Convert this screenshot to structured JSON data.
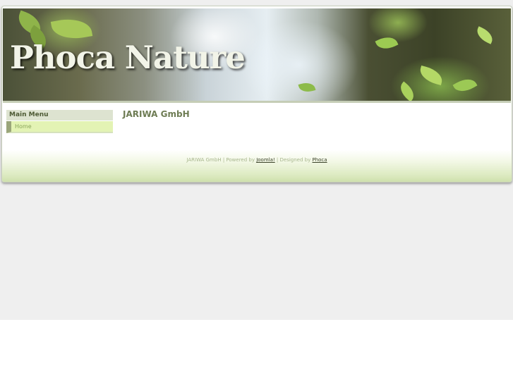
{
  "header": {
    "site_title": "Phoca Nature"
  },
  "sidebar": {
    "title": "Main Menu",
    "items": [
      {
        "label": "Home"
      }
    ]
  },
  "main": {
    "title": "JARIWA GmbH"
  },
  "footer": {
    "company": "JARIWA GmbH",
    "separator": " | ",
    "powered_by": "Powered by ",
    "joomla_link": "Joomla!",
    "designed_by": "Designed by ",
    "phoca_link": "Phoca"
  },
  "colors": {
    "page_bg": "#efefef",
    "menu_item_bg": "#e3f3b4",
    "title_color": "#6e7c54"
  }
}
